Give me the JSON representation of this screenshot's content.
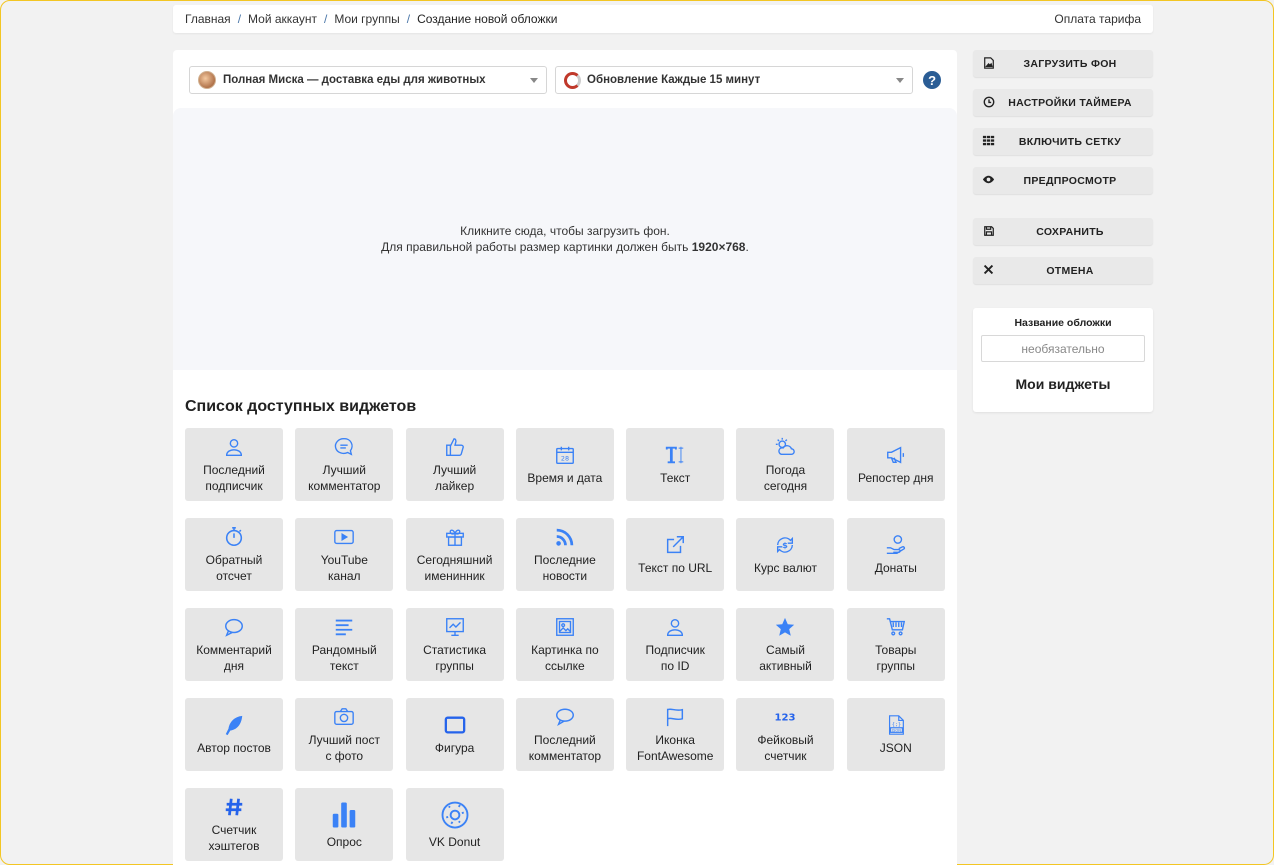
{
  "breadcrumb": {
    "items": [
      "Главная",
      "Мой аккаунт",
      "Мои группы",
      "Создание новой обложки"
    ],
    "separator": "/"
  },
  "header": {
    "pay_link": "Оплата тарифа"
  },
  "selects": {
    "group": "Полная Миска — доставка еды для животных",
    "timer": "Обновление Каждые 15 минут"
  },
  "upload": {
    "line1": "Кликните сюда, чтобы загрузить фон.",
    "line2_prefix": "Для правильной работы размер картинки должен быть ",
    "line2_size": "1920×768",
    "line2_suffix": "."
  },
  "widgets": {
    "title": "Список доступных виджетов",
    "items": [
      {
        "label": "Последний\nподписчик",
        "icon": "user-icon"
      },
      {
        "label": "Лучший\nкомментатор",
        "icon": "chat-icon"
      },
      {
        "label": "Лучший\nлайкер",
        "icon": "like-icon"
      },
      {
        "label": "Время и дата",
        "icon": "calendar-icon"
      },
      {
        "label": "Текст",
        "icon": "text-icon"
      },
      {
        "label": "Погода\nсегодня",
        "icon": "weather-icon"
      },
      {
        "label": "Репостер дня",
        "icon": "megaphone-icon"
      },
      {
        "label": "Обратный\nотсчет",
        "icon": "stopwatch-icon"
      },
      {
        "label": "YouTube\nканал",
        "icon": "youtube-icon"
      },
      {
        "label": "Сегодняшний\nименинник",
        "icon": "gift-icon"
      },
      {
        "label": "Последние\nновости",
        "icon": "rss-icon"
      },
      {
        "label": "Текст по URL",
        "icon": "external-link-icon"
      },
      {
        "label": "Курс валют",
        "icon": "currency-icon"
      },
      {
        "label": "Донаты",
        "icon": "donate-icon"
      },
      {
        "label": "Комментарий\nдня",
        "icon": "comment-icon"
      },
      {
        "label": "Рандомный\nтекст",
        "icon": "lines-icon"
      },
      {
        "label": "Статистика\nгруппы",
        "icon": "stats-icon"
      },
      {
        "label": "Картинка по\nссылке",
        "icon": "image-icon"
      },
      {
        "label": "Подписчик\nпо ID",
        "icon": "user-id-icon"
      },
      {
        "label": "Самый\nактивный",
        "icon": "star-icon"
      },
      {
        "label": "Товары\nгруппы",
        "icon": "cart-icon"
      },
      {
        "label": "Автор постов",
        "icon": "feather-icon"
      },
      {
        "label": "Лучший пост\nс фото",
        "icon": "camera-icon"
      },
      {
        "label": "Фигура",
        "icon": "shape-icon"
      },
      {
        "label": "Последний\nкомментатор",
        "icon": "speech-icon"
      },
      {
        "label": "Иконка\nFontAwesome",
        "icon": "flag-icon"
      },
      {
        "label": "Фейковый\nсчетчик",
        "icon": "counter-icon"
      },
      {
        "label": "JSON",
        "icon": "json-icon"
      },
      {
        "label": "Счетчик\nхэштегов",
        "icon": "hashtag-icon"
      },
      {
        "label": "Опрос",
        "icon": "poll-icon"
      },
      {
        "label": "VK Donut",
        "icon": "donut-icon"
      }
    ]
  },
  "sidebar": {
    "buttons": [
      {
        "label": "ЗАГРУЗИТЬ ФОН",
        "icon": "image-file-icon"
      },
      {
        "label": "НАСТРОЙКИ ТАЙМЕРА",
        "icon": "clock-icon"
      },
      {
        "label": "ВКЛЮЧИТЬ СЕТКУ",
        "icon": "grid-icon"
      },
      {
        "label": "ПРЕДПРОСМОТР",
        "icon": "eye-icon"
      },
      {
        "label": "СОХРАНИТЬ",
        "icon": "floppy-icon"
      },
      {
        "label": "ОТМЕНА",
        "icon": "times-icon"
      }
    ],
    "cover_name": {
      "title": "Название обложки",
      "placeholder": "необязательно",
      "my_widgets": "Мои виджеты"
    }
  },
  "colors": {
    "accent": "#3b82f6",
    "breadcrumb_separator": "#4a76a8",
    "help": "#2a5d95",
    "frame": "#f3c623"
  }
}
